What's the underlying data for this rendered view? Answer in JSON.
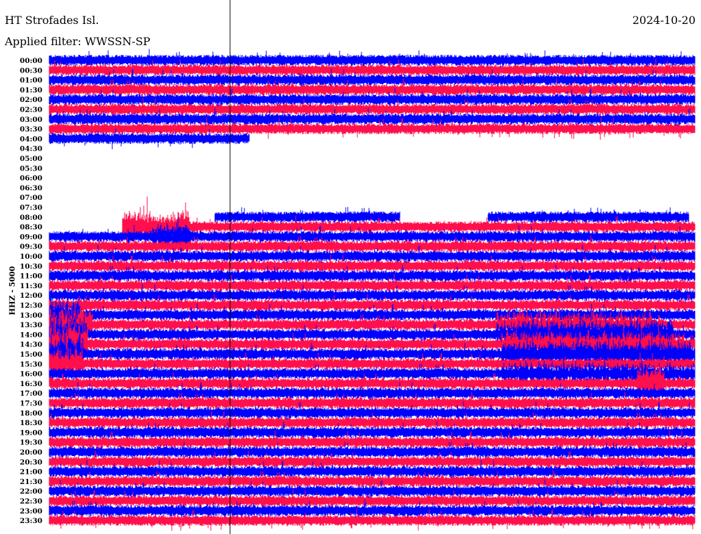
{
  "header": {
    "station": "HT Strofades Isl.",
    "filter": "Applied filter: WWSSN-SP",
    "date": "2024-10-20"
  },
  "chart_data": {
    "type": "line",
    "title": "HT Strofades Isl.",
    "subtitle": "Applied filter: WWSSN-SP",
    "date": "2024-10-20",
    "ylabel": "HHZ - 5000",
    "row_minutes": 30,
    "colors": [
      "#0000ff",
      "#ff0f4b"
    ],
    "marker_minute": 8.4,
    "rows": [
      "00:00",
      "00:30",
      "01:00",
      "01:30",
      "02:00",
      "02:30",
      "03:00",
      "03:30",
      "04:00",
      "04:30",
      "05:00",
      "05:30",
      "06:00",
      "06:30",
      "07:00",
      "07:30",
      "08:00",
      "08:30",
      "09:00",
      "09:30",
      "10:00",
      "10:30",
      "11:00",
      "11:30",
      "12:00",
      "12:30",
      "13:00",
      "13:30",
      "14:00",
      "14:30",
      "15:00",
      "15:30",
      "16:00",
      "16:30",
      "17:00",
      "17:30",
      "18:00",
      "18:30",
      "19:00",
      "19:30",
      "20:00",
      "20:30",
      "21:00",
      "21:30",
      "22:00",
      "22:30",
      "23:00",
      "23:30"
    ],
    "coverage_minutes": {
      "0": [
        [
          0,
          30
        ]
      ],
      "1": [
        [
          0,
          30
        ]
      ],
      "2": [
        [
          0,
          30
        ]
      ],
      "3": [
        [
          0,
          30
        ]
      ],
      "4": [
        [
          0,
          30
        ]
      ],
      "5": [
        [
          0,
          30
        ]
      ],
      "6": [
        [
          0,
          30
        ]
      ],
      "7": [
        [
          0,
          30
        ]
      ],
      "8": [
        [
          0,
          9.3
        ]
      ],
      "16": [
        [
          7.7,
          16.3
        ],
        [
          20.4,
          29.7
        ]
      ],
      "17": [
        [
          3.4,
          30
        ]
      ],
      "default_from_row": 18
    },
    "events": [
      {
        "row": 17,
        "from": 1.8,
        "to": 6.5,
        "amp": 2.5
      },
      {
        "row": 18,
        "from": 4.8,
        "to": 6.5,
        "amp": 2.2
      },
      {
        "row": 26,
        "from": 0,
        "to": 1.5,
        "amp": 2.5
      },
      {
        "row": 27,
        "from": 0,
        "to": 2,
        "amp": 3
      },
      {
        "row": 28,
        "from": 0,
        "to": 1.8,
        "amp": 3
      },
      {
        "row": 29,
        "from": 0,
        "to": 1.8,
        "amp": 3.5
      },
      {
        "row": 30,
        "from": 0,
        "to": 1.6,
        "amp": 3
      },
      {
        "row": 31,
        "from": 0,
        "to": 1.6,
        "amp": 2.5
      },
      {
        "row": 27,
        "from": 20.8,
        "to": 28,
        "amp": 2.2
      },
      {
        "row": 28,
        "from": 20.8,
        "to": 29,
        "amp": 2.5
      },
      {
        "row": 29,
        "from": 21,
        "to": 29.5,
        "amp": 2.2
      },
      {
        "row": 30,
        "from": 21,
        "to": 30,
        "amp": 2.2
      },
      {
        "row": 32,
        "from": 21,
        "to": 30,
        "amp": 1.8
      },
      {
        "row": 33,
        "from": 27.3,
        "to": 28.6,
        "amp": 3
      }
    ]
  }
}
